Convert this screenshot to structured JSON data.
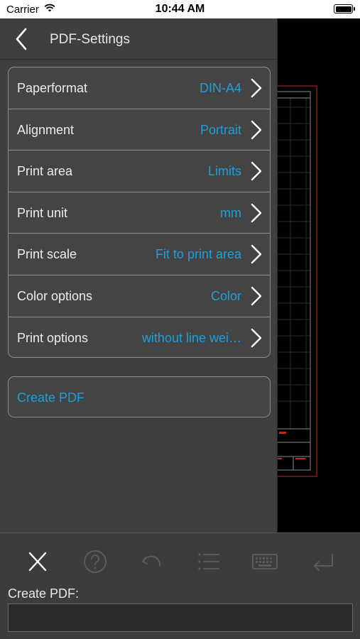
{
  "status_bar": {
    "carrier": "Carrier",
    "time": "10:44 AM",
    "icons": [
      "wifi-icon",
      "battery-icon"
    ]
  },
  "header": {
    "title": "PDF-Settings",
    "back_icon": "chevron-left-icon"
  },
  "settings": [
    {
      "label": "Paperformat",
      "value": "DIN-A4"
    },
    {
      "label": "Alignment",
      "value": "Portrait"
    },
    {
      "label": "Print area",
      "value": "Limits"
    },
    {
      "label": "Print unit",
      "value": "mm"
    },
    {
      "label": "Print scale",
      "value": "Fit to print area"
    },
    {
      "label": "Color options",
      "value": "Color"
    },
    {
      "label": "Print options",
      "value": "without line wei…"
    }
  ],
  "create_button": {
    "label": "Create PDF"
  },
  "toolbar": {
    "icons": [
      "close-icon",
      "help-icon",
      "undo-icon",
      "list-icon",
      "keyboard-icon",
      "enter-icon"
    ],
    "command_label": "Create PDF:",
    "command_value": ""
  },
  "colors": {
    "accent": "#1e9fd9",
    "panel_bg": "#3f3f3f",
    "drawing_bg": "#000000",
    "frame_red": "#c0282a"
  }
}
